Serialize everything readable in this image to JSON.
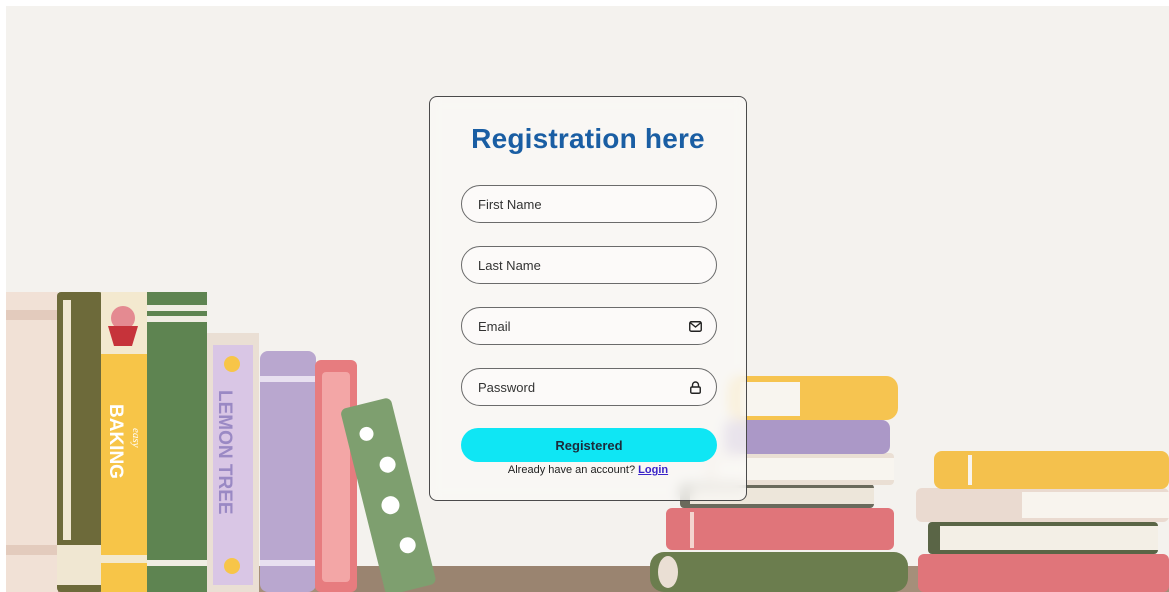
{
  "form": {
    "title": "Registration here",
    "fields": {
      "first_name": {
        "placeholder": "First Name"
      },
      "last_name": {
        "placeholder": "Last Name"
      },
      "email": {
        "placeholder": "Email",
        "icon": "envelope-icon"
      },
      "password": {
        "placeholder": "Password",
        "icon": "lock-icon"
      }
    },
    "submit_label": "Registered",
    "footer_text": "Already have an account? ",
    "login_link": "Login"
  },
  "background": {
    "book_spines": [
      "BAKING",
      "easy",
      "LEMON TREE"
    ]
  },
  "colors": {
    "title": "#1a5ea3",
    "button": "#0fe6f4",
    "link": "#3a23c8",
    "background": "#f4f2ee"
  }
}
